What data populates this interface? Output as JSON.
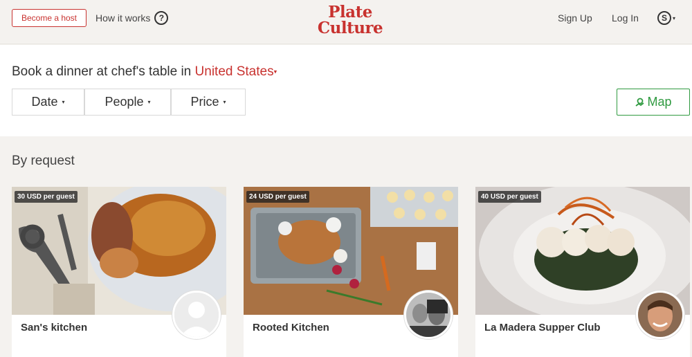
{
  "header": {
    "become_host": "Become a host",
    "how_it_works": "How it works",
    "help_icon": "?",
    "logo_line1": "Plate",
    "logo_line2": "Culture",
    "sign_up": "Sign Up",
    "log_in": "Log In",
    "currency_icon": "S",
    "currency_caret": "▾"
  },
  "search": {
    "headline_prefix": "Book a dinner at chef's table in",
    "country": "United States",
    "country_caret": "▾",
    "filters": [
      {
        "label": "Date",
        "caret": "▾"
      },
      {
        "label": "People",
        "caret": "▾"
      },
      {
        "label": "Price",
        "caret": "▾"
      }
    ],
    "map_label": "Map"
  },
  "listings": {
    "section_title": "By request",
    "cards": [
      {
        "price": "30 USD per guest",
        "title": "San's kitchen"
      },
      {
        "price": "24 USD per guest",
        "title": "Rooted Kitchen"
      },
      {
        "price": "40 USD per guest",
        "title": "La Madera Supper Club"
      }
    ]
  },
  "colors": {
    "brand_red": "#c8322f",
    "map_green": "#2f9a40",
    "background": "#f4f2ef"
  },
  "icons": {
    "help": "help-circle-icon",
    "currency": "currency-circle-icon",
    "map": "map-pin-icon"
  }
}
